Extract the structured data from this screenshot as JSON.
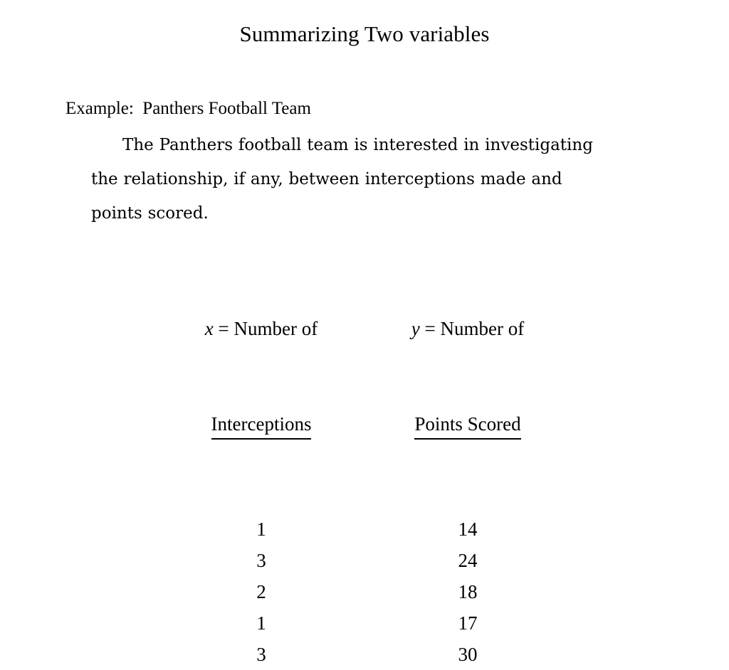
{
  "slide": {
    "title": "Summarizing Two variables",
    "example_label": "Example:  Panthers Football Team",
    "paragraph": "The Panthers football team is interested in investigating the relationship, if any, between interceptions made and points scored.",
    "background_color": "#ffffff",
    "text_color": "#000000"
  },
  "table": {
    "columns": [
      {
        "variable": "x",
        "head_line1": " = Number of",
        "head_line2": "Interceptions"
      },
      {
        "variable": "y",
        "head_line1": " = Number of",
        "head_line2": "Points Scored"
      }
    ],
    "rows": [
      {
        "x": "1",
        "y": "14"
      },
      {
        "x": "3",
        "y": "24"
      },
      {
        "x": "2",
        "y": "18"
      },
      {
        "x": "1",
        "y": "17"
      },
      {
        "x": "3",
        "y": "30"
      }
    ]
  }
}
